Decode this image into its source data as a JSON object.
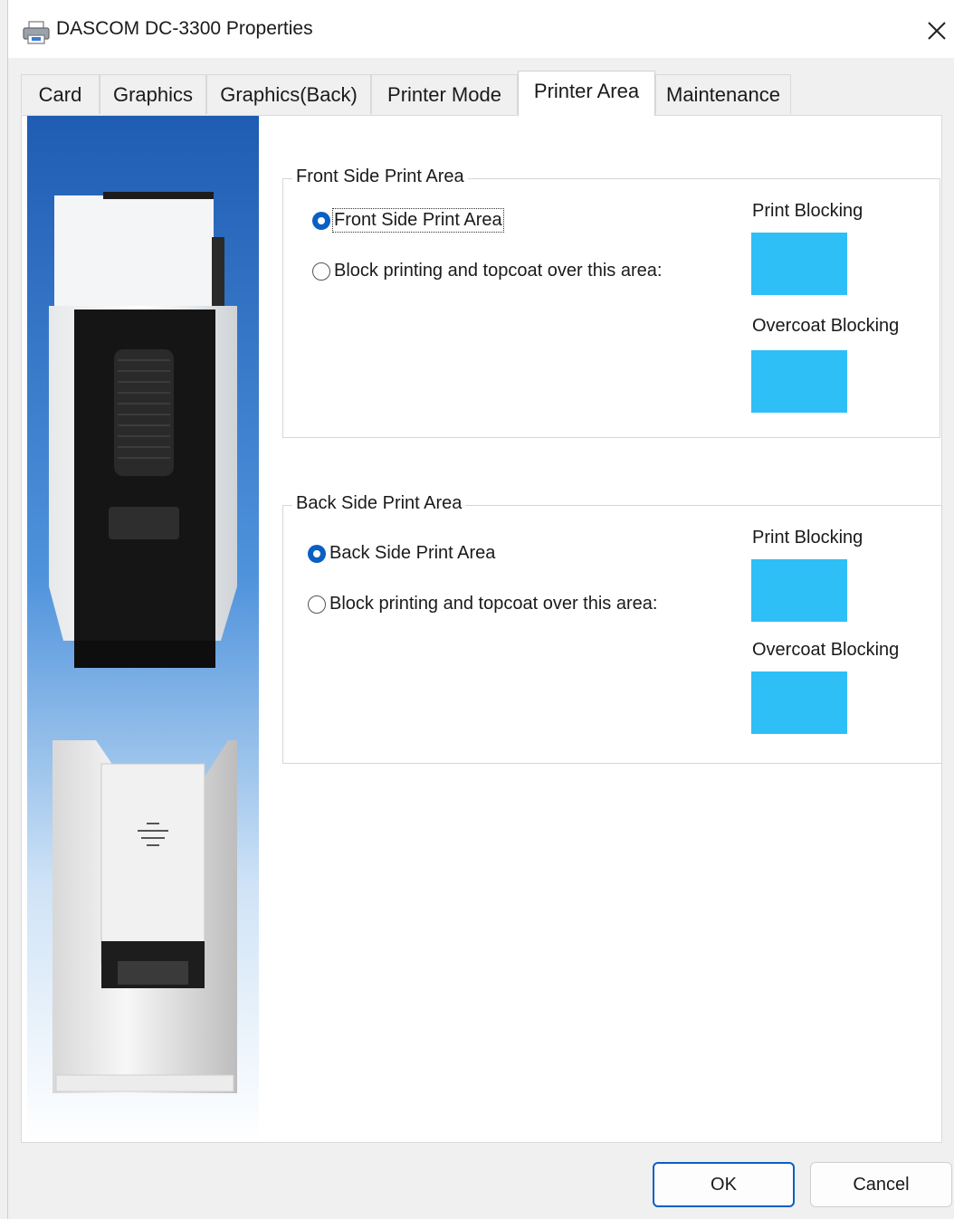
{
  "window": {
    "title": "DASCOM DC-3300 Properties"
  },
  "tabs": [
    {
      "label": "Card"
    },
    {
      "label": "Graphics"
    },
    {
      "label": "Graphics(Back)"
    },
    {
      "label": "Printer Mode"
    },
    {
      "label": "Printer Area",
      "active": true
    },
    {
      "label": "Maintenance"
    }
  ],
  "front": {
    "group_title": "Front Side Print Area",
    "option_full": "Front Side Print Area",
    "option_block": "Block printing and topcoat over this area:",
    "selected": "option_full",
    "print_blocking_label": "Print Blocking",
    "overcoat_blocking_label": "Overcoat Blocking"
  },
  "back": {
    "group_title": "Back Side Print Area",
    "option_full": "Back Side Print Area",
    "option_block": "Block printing and topcoat over this area:",
    "selected": "option_full",
    "print_blocking_label": "Print Blocking",
    "overcoat_blocking_label": "Overcoat Blocking"
  },
  "colors": {
    "blocking_swatch": "#2ebff7",
    "radio_selected": "#0a5fc4"
  },
  "buttons": {
    "ok": "OK",
    "cancel": "Cancel"
  }
}
